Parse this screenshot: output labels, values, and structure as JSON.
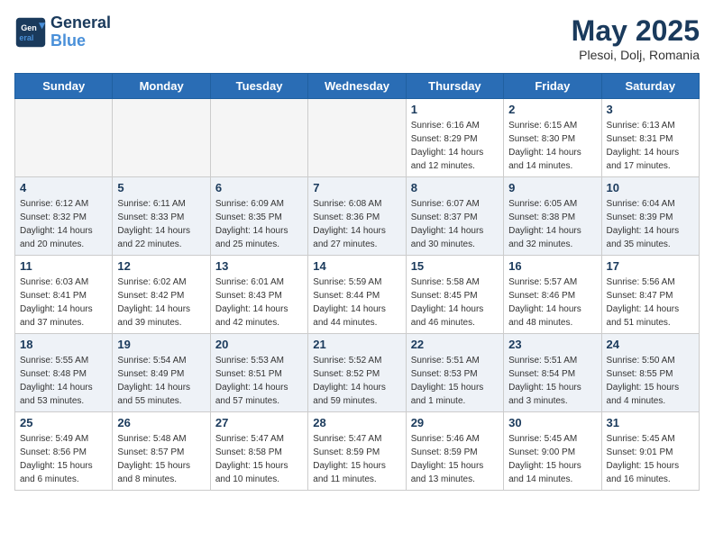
{
  "header": {
    "logo_line1": "General",
    "logo_line2": "Blue",
    "month": "May 2025",
    "location": "Plesoi, Dolj, Romania"
  },
  "weekdays": [
    "Sunday",
    "Monday",
    "Tuesday",
    "Wednesday",
    "Thursday",
    "Friday",
    "Saturday"
  ],
  "weeks": [
    [
      {
        "day": "",
        "empty": true
      },
      {
        "day": "",
        "empty": true
      },
      {
        "day": "",
        "empty": true
      },
      {
        "day": "",
        "empty": true
      },
      {
        "day": "1",
        "sunrise": "6:16 AM",
        "sunset": "8:29 PM",
        "daylight": "14 hours and 12 minutes."
      },
      {
        "day": "2",
        "sunrise": "6:15 AM",
        "sunset": "8:30 PM",
        "daylight": "14 hours and 14 minutes."
      },
      {
        "day": "3",
        "sunrise": "6:13 AM",
        "sunset": "8:31 PM",
        "daylight": "14 hours and 17 minutes."
      }
    ],
    [
      {
        "day": "4",
        "sunrise": "6:12 AM",
        "sunset": "8:32 PM",
        "daylight": "14 hours and 20 minutes."
      },
      {
        "day": "5",
        "sunrise": "6:11 AM",
        "sunset": "8:33 PM",
        "daylight": "14 hours and 22 minutes."
      },
      {
        "day": "6",
        "sunrise": "6:09 AM",
        "sunset": "8:35 PM",
        "daylight": "14 hours and 25 minutes."
      },
      {
        "day": "7",
        "sunrise": "6:08 AM",
        "sunset": "8:36 PM",
        "daylight": "14 hours and 27 minutes."
      },
      {
        "day": "8",
        "sunrise": "6:07 AM",
        "sunset": "8:37 PM",
        "daylight": "14 hours and 30 minutes."
      },
      {
        "day": "9",
        "sunrise": "6:05 AM",
        "sunset": "8:38 PM",
        "daylight": "14 hours and 32 minutes."
      },
      {
        "day": "10",
        "sunrise": "6:04 AM",
        "sunset": "8:39 PM",
        "daylight": "14 hours and 35 minutes."
      }
    ],
    [
      {
        "day": "11",
        "sunrise": "6:03 AM",
        "sunset": "8:41 PM",
        "daylight": "14 hours and 37 minutes."
      },
      {
        "day": "12",
        "sunrise": "6:02 AM",
        "sunset": "8:42 PM",
        "daylight": "14 hours and 39 minutes."
      },
      {
        "day": "13",
        "sunrise": "6:01 AM",
        "sunset": "8:43 PM",
        "daylight": "14 hours and 42 minutes."
      },
      {
        "day": "14",
        "sunrise": "5:59 AM",
        "sunset": "8:44 PM",
        "daylight": "14 hours and 44 minutes."
      },
      {
        "day": "15",
        "sunrise": "5:58 AM",
        "sunset": "8:45 PM",
        "daylight": "14 hours and 46 minutes."
      },
      {
        "day": "16",
        "sunrise": "5:57 AM",
        "sunset": "8:46 PM",
        "daylight": "14 hours and 48 minutes."
      },
      {
        "day": "17",
        "sunrise": "5:56 AM",
        "sunset": "8:47 PM",
        "daylight": "14 hours and 51 minutes."
      }
    ],
    [
      {
        "day": "18",
        "sunrise": "5:55 AM",
        "sunset": "8:48 PM",
        "daylight": "14 hours and 53 minutes."
      },
      {
        "day": "19",
        "sunrise": "5:54 AM",
        "sunset": "8:49 PM",
        "daylight": "14 hours and 55 minutes."
      },
      {
        "day": "20",
        "sunrise": "5:53 AM",
        "sunset": "8:51 PM",
        "daylight": "14 hours and 57 minutes."
      },
      {
        "day": "21",
        "sunrise": "5:52 AM",
        "sunset": "8:52 PM",
        "daylight": "14 hours and 59 minutes."
      },
      {
        "day": "22",
        "sunrise": "5:51 AM",
        "sunset": "8:53 PM",
        "daylight": "15 hours and 1 minute."
      },
      {
        "day": "23",
        "sunrise": "5:51 AM",
        "sunset": "8:54 PM",
        "daylight": "15 hours and 3 minutes."
      },
      {
        "day": "24",
        "sunrise": "5:50 AM",
        "sunset": "8:55 PM",
        "daylight": "15 hours and 4 minutes."
      }
    ],
    [
      {
        "day": "25",
        "sunrise": "5:49 AM",
        "sunset": "8:56 PM",
        "daylight": "15 hours and 6 minutes."
      },
      {
        "day": "26",
        "sunrise": "5:48 AM",
        "sunset": "8:57 PM",
        "daylight": "15 hours and 8 minutes."
      },
      {
        "day": "27",
        "sunrise": "5:47 AM",
        "sunset": "8:58 PM",
        "daylight": "15 hours and 10 minutes."
      },
      {
        "day": "28",
        "sunrise": "5:47 AM",
        "sunset": "8:59 PM",
        "daylight": "15 hours and 11 minutes."
      },
      {
        "day": "29",
        "sunrise": "5:46 AM",
        "sunset": "8:59 PM",
        "daylight": "15 hours and 13 minutes."
      },
      {
        "day": "30",
        "sunrise": "5:45 AM",
        "sunset": "9:00 PM",
        "daylight": "15 hours and 14 minutes."
      },
      {
        "day": "31",
        "sunrise": "5:45 AM",
        "sunset": "9:01 PM",
        "daylight": "15 hours and 16 minutes."
      }
    ]
  ]
}
